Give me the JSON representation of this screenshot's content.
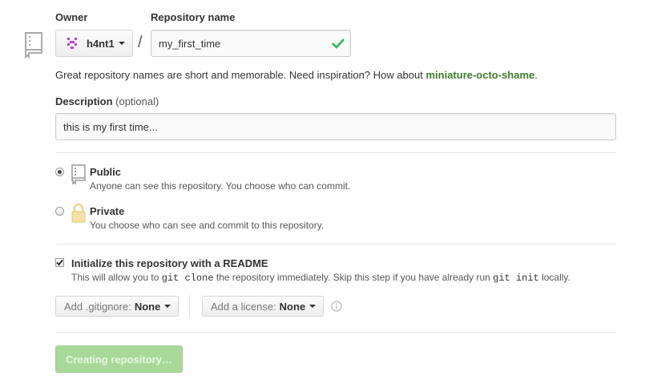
{
  "owner": {
    "label": "Owner",
    "name": "h4nt1",
    "avatar_color": "#b845d6"
  },
  "separator": "/",
  "repo": {
    "label": "Repository name",
    "value": "my_first_time",
    "valid_color": "#2cbe4e"
  },
  "suggestion": {
    "text": "Great repository names are short and memorable. Need inspiration? How about ",
    "name": "miniature-octo-shame",
    "end": "."
  },
  "description": {
    "label": "Description",
    "optional": "(optional)",
    "value": "this is my first time..."
  },
  "visibility": {
    "public": {
      "title": "Public",
      "desc": "Anyone can see this repository. You choose who can commit.",
      "selected": true
    },
    "private": {
      "title": "Private",
      "desc": "You choose who can see and commit to this repository.",
      "selected": false
    }
  },
  "init": {
    "checked": true,
    "label": "Initialize this repository with a README",
    "desc_pre": "This will allow you to ",
    "code1": "git clone",
    "desc_mid": " the repository immediately. Skip this step if you have already run ",
    "code2": "git init",
    "desc_post": " locally."
  },
  "gitignore": {
    "prefix": "Add .gitignore:",
    "value": "None"
  },
  "license": {
    "prefix": "Add a license:",
    "value": "None"
  },
  "submit": {
    "label": "Creating repository…",
    "color": "#a6d99a"
  },
  "icons": [
    "repo-icon",
    "avatar-icon",
    "check-icon",
    "public-repo-icon",
    "lock-icon",
    "info-icon",
    "checkbox-icon"
  ]
}
